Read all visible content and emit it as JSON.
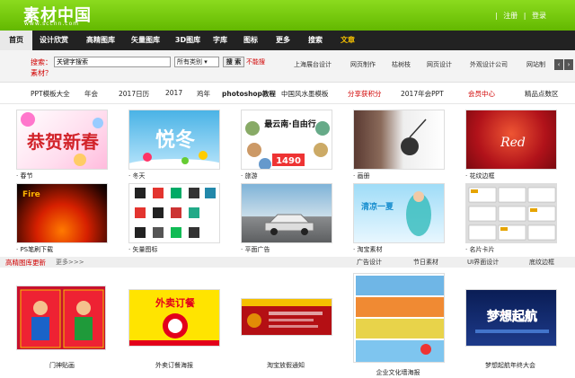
{
  "brand": {
    "logo": "素材中国",
    "url": "www.sccnn.com",
    "accent": "#6cc20e"
  },
  "top_links": {
    "register": "注册",
    "login": "登录",
    "sep": "|"
  },
  "nav": {
    "items": [
      "首页",
      "设计欣赏",
      "高精图库",
      "矢量图库",
      "3D图库",
      "字库",
      "图标",
      "更多",
      "搜索",
      "文章"
    ]
  },
  "search": {
    "label": "搜索：",
    "label2": "素材？",
    "placeholder": "关键字搜索",
    "select": "所有类别",
    "button": "搜 索",
    "notice": "不能搜"
  },
  "partners": [
    "上海展台设计",
    "网页制作",
    "枯树枝",
    "网页设计",
    "外观设计公司",
    "网站制"
  ],
  "categories": [
    "PPT模板大全",
    "年会",
    "2017日历",
    "2017",
    "鸡年",
    "photoshop教程",
    "中国风水墨模板",
    "分享获积分",
    "2017年会PPT",
    "会员中心",
    "精品点数区"
  ],
  "grid_row1": [
    "· 春节",
    "· 冬天",
    "· 旅游",
    "· 画册",
    "· 花纹边框"
  ],
  "grid_row2": [
    "· PS笔刷下载",
    "· 矢量图标",
    "· 平面广告",
    "· 淘宝素材",
    "· 名片卡片"
  ],
  "section": {
    "title": "高精图库更新",
    "more": "更多>>>",
    "links": [
      "广告设计",
      "节日素材",
      "UI界面设计",
      "底纹边框"
    ]
  },
  "bottom_row": [
    "门神贴画",
    "外卖订餐海报",
    "淘宝放假通知",
    "企业文化墙海报",
    "梦想起航年终大会"
  ],
  "thumb_text": {
    "spring": "恭贺新春",
    "winter": "悦冬",
    "travel": "最云南·自由行",
    "price": "1490",
    "red": "Red",
    "fire": "Fire",
    "qing": "清凉一夏",
    "waimai": "外卖订餐",
    "dream": "梦想起航"
  }
}
